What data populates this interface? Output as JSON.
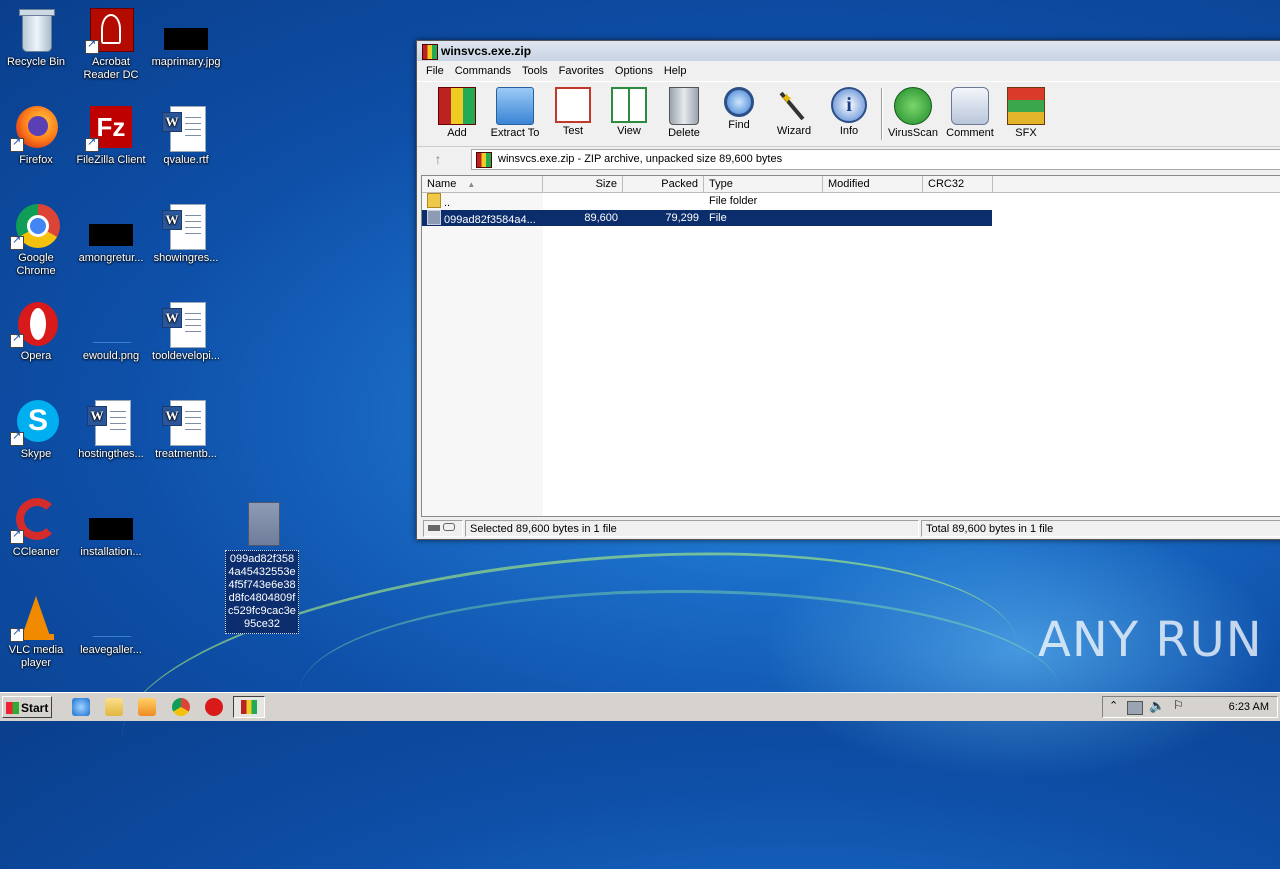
{
  "desktop": {
    "icons": [
      {
        "label": "Recycle Bin"
      },
      {
        "label": "Acrobat Reader DC"
      },
      {
        "label": "maprimary.jpg"
      },
      {
        "label": "Firefox"
      },
      {
        "label": "FileZilla Client"
      },
      {
        "label": "qvalue.rtf"
      },
      {
        "label": "Google Chrome"
      },
      {
        "label": "amongretur..."
      },
      {
        "label": "showingres..."
      },
      {
        "label": "Opera"
      },
      {
        "label": "ewould.png"
      },
      {
        "label": "tooldevelopi..."
      },
      {
        "label": "Skype"
      },
      {
        "label": "hostingthes..."
      },
      {
        "label": "treatmentb..."
      },
      {
        "label": "CCleaner"
      },
      {
        "label": "installation..."
      },
      {
        "label": "VLC media player"
      },
      {
        "label": "leavegaller..."
      }
    ],
    "selected_file_label": "099ad82f3584a45432553e4f5f743e6e38d8fc4804809fc529fc9cac3e95ce32",
    "watermark": "ANY RUN"
  },
  "window": {
    "title": "winsvcs.exe.zip",
    "menu": [
      "File",
      "Commands",
      "Tools",
      "Favorites",
      "Options",
      "Help"
    ],
    "toolbar": [
      "Add",
      "Extract To",
      "Test",
      "View",
      "Delete",
      "Find",
      "Wizard",
      "Info",
      "VirusScan",
      "Comment",
      "SFX"
    ],
    "address": "winsvcs.exe.zip - ZIP archive, unpacked size 89,600 bytes",
    "columns": [
      "Name",
      "Size",
      "Packed",
      "Type",
      "Modified",
      "CRC32"
    ],
    "rows": [
      {
        "name": "..",
        "size": "",
        "packed": "",
        "type": "File folder",
        "modified": "",
        "crc": ""
      },
      {
        "name": "099ad82f3584a4...",
        "size": "89,600",
        "packed": "79,299",
        "type": "File",
        "modified": "",
        "crc": ""
      }
    ],
    "status_left": "Selected 89,600 bytes in 1 file",
    "status_right": "Total 89,600 bytes in 1 file"
  },
  "taskbar": {
    "start": "Start",
    "clock": "6:23 AM"
  }
}
